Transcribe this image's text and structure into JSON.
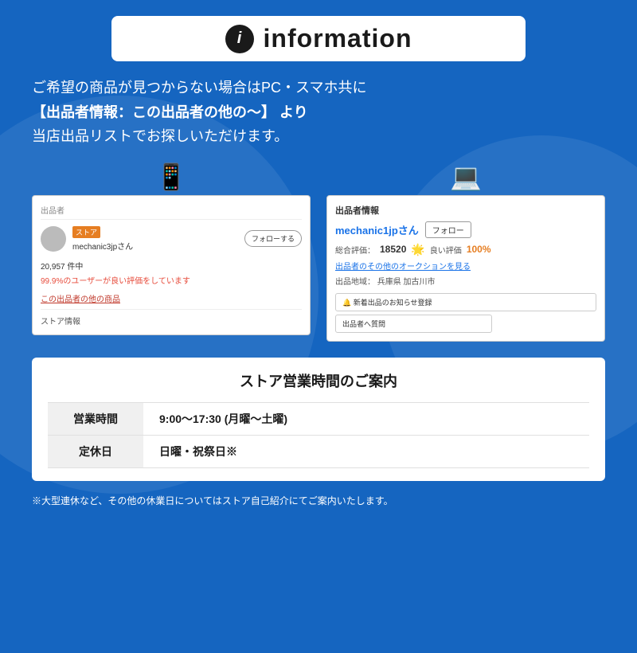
{
  "header": {
    "icon_label": "i",
    "title": "information"
  },
  "main_text": {
    "line1": "ご希望の商品が見つからない場合はPC・スマホ共に",
    "line2": "【出品者情報：この出品者の他の〜】 より",
    "line3": "当店出品リストでお探しいただけます。"
  },
  "mobile_screenshot": {
    "seller_label": "出品者",
    "store_badge": "ストア",
    "seller_name": "mechanic3jpさん",
    "follow_button": "フォローする",
    "review_count": "20,957 件中",
    "review_pct": "99.9%のユーザーが良い評価をしています",
    "other_items_link": "この出品者の他の商品",
    "store_info": "ストア情報"
  },
  "pc_screenshot": {
    "header": "出品者情報",
    "seller_name": "mechanic1jpさん",
    "follow_button": "フォロー",
    "rating_label": "総合評価：",
    "rating_num": "18520",
    "good_label": "良い評価",
    "good_pct": "100%",
    "auction_link": "出品者のその他のオークションを見る",
    "location_label": "出品地域：",
    "location_value": "兵庫県 加古川市",
    "notify_button": "🔔 新着出品のお知らせ登録",
    "question_button": "出品者へ質問"
  },
  "store_hours": {
    "title": "ストア営業時間のご案内",
    "rows": [
      {
        "label": "営業時間",
        "value": "9:00〜17:30 (月曜〜土曜)"
      },
      {
        "label": "定休日",
        "value": "日曜・祝祭日※"
      }
    ]
  },
  "footer_note": "※大型連休など、その他の休業日についてはストア自己紹介にてご案内いたします。",
  "colors": {
    "background": "#1565c0",
    "white": "#ffffff",
    "accent_red": "#e74c3c",
    "accent_blue": "#1a73e8",
    "accent_orange": "#e67e22"
  }
}
